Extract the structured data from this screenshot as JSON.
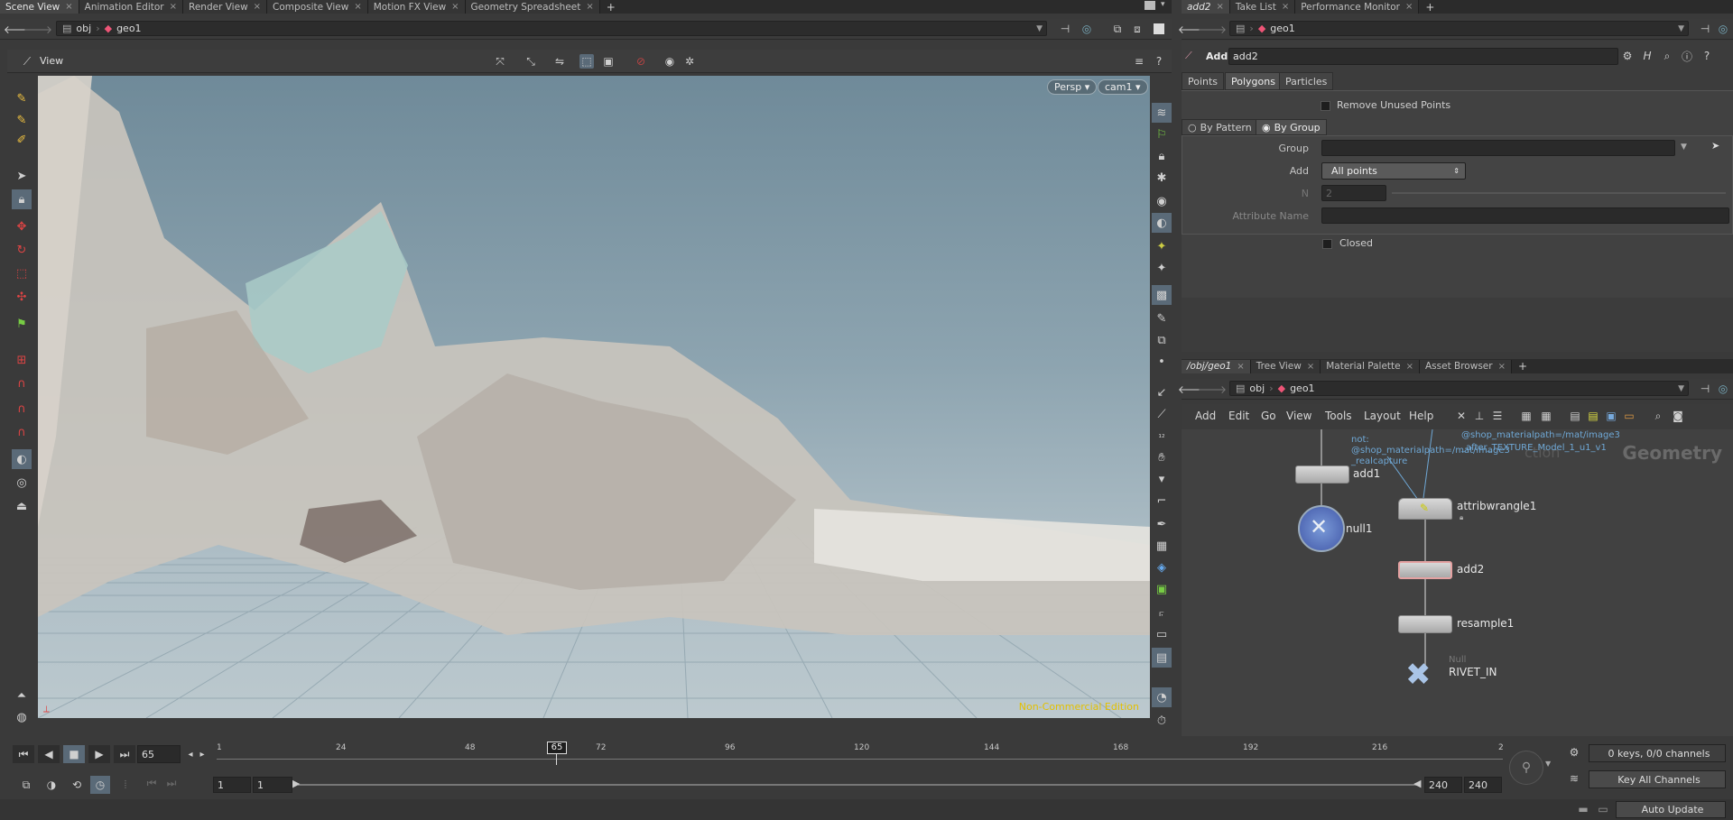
{
  "left_tabs": [
    "Scene View",
    "Animation Editor",
    "Render View",
    "Composite View",
    "Motion FX View",
    "Geometry Spreadsheet"
  ],
  "right_top_tabs": [
    "add2",
    "Take List",
    "Performance Monitor"
  ],
  "left_path": {
    "root": "obj",
    "node": "geo1"
  },
  "right_path": {
    "node": "geo1"
  },
  "viewer": {
    "title": "View",
    "persp": "Persp ▾",
    "cam": "cam1 ▾",
    "watermark": "Non-Commercial Edition"
  },
  "params": {
    "op_type": "Add",
    "op_name": "add2",
    "tabs": [
      "Points",
      "Polygons",
      "Particles"
    ],
    "remove_unused": "Remove Unused Points",
    "mode_tabs": [
      "By Pattern",
      "By Group"
    ],
    "group_label": "Group",
    "add_label": "Add",
    "add_value": "All points",
    "n_label": "N",
    "n_value": "2",
    "attr_label": "Attribute Name",
    "closed_label": "Closed"
  },
  "net_tabs": [
    "/obj/geo1",
    "Tree View",
    "Material Palette",
    "Asset Browser"
  ],
  "net_path": {
    "root": "obj",
    "node": "geo1"
  },
  "net_menu": [
    "Add",
    "Edit",
    "Go",
    "View",
    "Tools",
    "Layout",
    "Help"
  ],
  "network": {
    "context_label": "Geometry",
    "faded_label": "ction",
    "note1": "not:\n@shop_materialpath=/mat/image3\n_realcapture",
    "note2": "@shop_materialpath=/mat/image3\n_after_TEXTURE_Model_1_u1_v1",
    "nodes": {
      "add1": "add1",
      "null1": "null1",
      "attribwrangle1": "attribwrangle1",
      "add2": "add2",
      "resample1": "resample1",
      "rivet_type": "Null",
      "rivet": "RIVET_IN"
    }
  },
  "timeline": {
    "current_frame": "65",
    "marker": "65",
    "ticks": [
      "1",
      "24",
      "48",
      "72",
      "96",
      "120",
      "144",
      "168",
      "192",
      "216",
      "2"
    ],
    "start": "1",
    "start2": "1",
    "end": "240",
    "end2": "240",
    "keys": "0 keys, 0/0 channels",
    "key_all": "Key All Channels",
    "auto_update": "Auto Update"
  },
  "colors": {
    "accent": "#e3c000",
    "selected_node": "#e4a1a1",
    "wire": "#6fa8d6"
  }
}
